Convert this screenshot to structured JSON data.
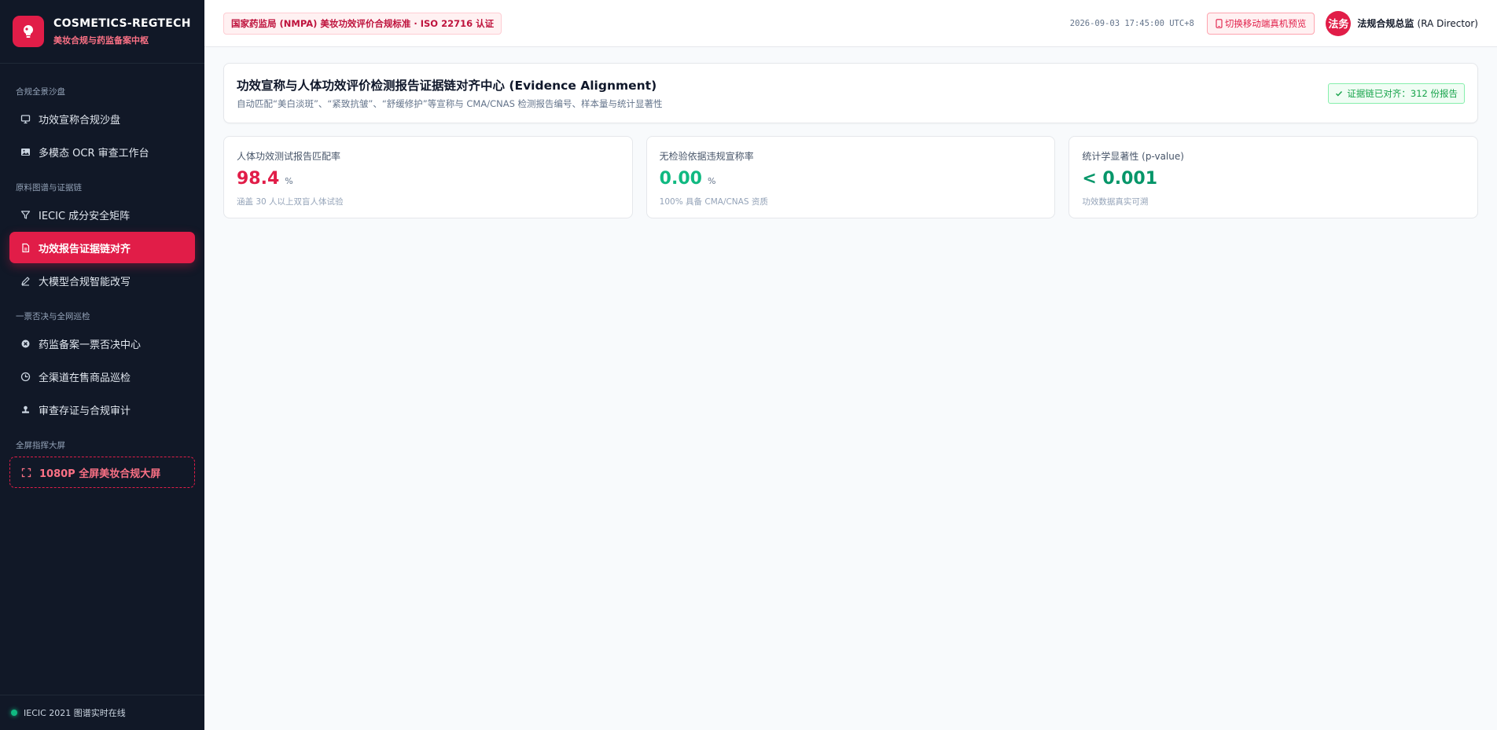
{
  "brand": {
    "name": "COSMETICS-REGTECH",
    "subtitle": "美妆合规与药监备案中枢"
  },
  "sidebar": {
    "sections": [
      {
        "title": "合规全景沙盘",
        "items": [
          {
            "label": "功效宣称合规沙盘",
            "icon": "monitor-icon"
          },
          {
            "label": "多模态 OCR 审查工作台",
            "icon": "image-icon"
          }
        ]
      },
      {
        "title": "原料图谱与证据链",
        "items": [
          {
            "label": "IECIC 成分安全矩阵",
            "icon": "filter-icon"
          },
          {
            "label": "功效报告证据链对齐",
            "icon": "document-icon",
            "active": true
          },
          {
            "label": "大模型合规智能改写",
            "icon": "pen-icon"
          }
        ]
      },
      {
        "title": "一票否决与全网巡检",
        "items": [
          {
            "label": "药监备案一票否决中心",
            "icon": "x-circle-icon"
          },
          {
            "label": "全渠道在售商品巡检",
            "icon": "clock-icon"
          },
          {
            "label": "审查存证与合规审计",
            "icon": "stamp-icon"
          }
        ]
      },
      {
        "title": "全屏指挥大屏",
        "items": [
          {
            "label": "1080P 全屏美妆合规大屏",
            "icon": "fullscreen-icon",
            "dashed": true
          }
        ]
      }
    ],
    "footer": "IECIC 2021 图谱实时在线"
  },
  "header": {
    "cert_badge": "国家药监局 (NMPA) 美妆功效评价合规标准 · ISO 22716 认证",
    "clock": "2026-09-03 17:45:00 UTC+8",
    "mobile_button": "切换移动端真机预览",
    "avatar_text": "法务",
    "user_name": "法规合规总监",
    "user_role": "(RA Director)"
  },
  "panel": {
    "title": "功效宣称与人体功效评价检测报告证据链对齐中心 (Evidence Alignment)",
    "subtitle": "自动匹配“美白淡斑”、“紧致抗皱”、“舒缓修护”等宣称与 CMA/CNAS 检测报告编号、样本量与统计显著性",
    "badge": "证据链已对齐：312 份报告"
  },
  "cards": [
    {
      "label": "人体功效测试报告匹配率",
      "value": "98.4",
      "unit": "%",
      "note": "涵盖 30 人以上双盲人体试验"
    },
    {
      "label": "无检验依据违规宣称率",
      "value": "0.00",
      "unit": "%",
      "note": "100% 具备 CMA/CNAS 资质"
    },
    {
      "label": "统计学显著性 (p-value)",
      "value": "< 0.001",
      "unit": "",
      "note": "功效数据真实可溯"
    }
  ],
  "colors": {
    "accent": "#e11d48",
    "sidebar_bg": "#111827",
    "success": "#10b981"
  }
}
